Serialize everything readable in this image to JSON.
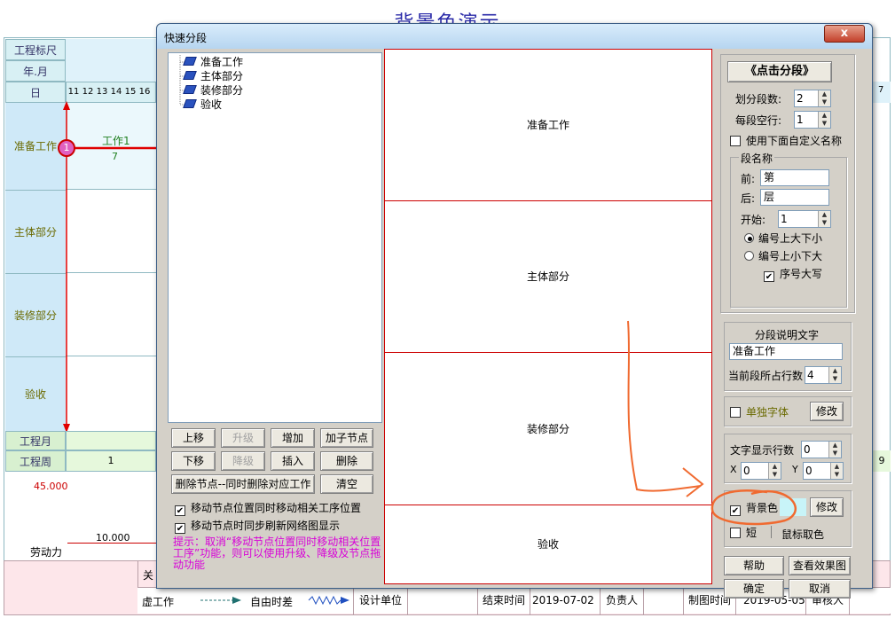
{
  "background": {
    "title": "背景色演示",
    "scale_label": "工程标尺",
    "yearmonth_label": "年.月",
    "day_label": "日",
    "days": [
      "11",
      "12",
      "13",
      "14",
      "15",
      "16"
    ],
    "lanes": [
      "准备工作",
      "主体部分",
      "装修部分",
      "验收"
    ],
    "task": {
      "name": "工作1",
      "duration": "7",
      "node": "1"
    },
    "month_label": "工程月",
    "week_label": "工程周",
    "week_first": "1",
    "week_right": "9",
    "day_right": "7",
    "value_top": "45.000",
    "value_mid": "10.000",
    "labor_label": "劳动力",
    "legend": {
      "crit_abbr": "关",
      "virtual": "虚工作",
      "free_float": "自由时差",
      "design_unit": "设计单位",
      "end_time_label": "结束时间",
      "end_time": "2019-07-02",
      "owner_label": "负责人",
      "draw_time_label": "制图时间",
      "draw_time": "2019-05-05",
      "reviewer_label": "审核人"
    }
  },
  "dialog": {
    "title": "快速分段",
    "close_label": "x",
    "tree_items": [
      "准备工作",
      "主体部分",
      "装修部分",
      "验收"
    ],
    "buttons": {
      "up": "上移",
      "promote": "升级",
      "add": "增加",
      "add_child": "加子节点",
      "down": "下移",
      "demote": "降级",
      "insert": "插入",
      "delete": "删除",
      "delete_node": "删除节点--同时删除对应工作",
      "clear": "清空"
    },
    "checks": {
      "move_related": "移动节点位置同时移动相关工序位置",
      "sync_refresh": "移动节点时同步刷新网络图显示"
    },
    "hint": "提示：取消“移动节点位置同时移动相关位置工序”功能，则可以使用升级、降级及节点拖动功能",
    "preview_segments": [
      "准备工作",
      "主体部分",
      "装修部分",
      "验收"
    ],
    "right": {
      "split_button": "《点击分段》",
      "seg_count_label": "划分段数:",
      "seg_count": "2",
      "blank_rows_label": "每段空行:",
      "blank_rows": "1",
      "use_custom_label": "使用下面自定义名称",
      "seg_name_group": "段名称",
      "prefix_label": "前:",
      "prefix": "第",
      "suffix_label": "后:",
      "suffix": "层",
      "start_label": "开始:",
      "start": "1",
      "order_big_small": "编号上大下小",
      "order_small_big": "编号上小下大",
      "uppercase": "序号大写",
      "desc_group": "分段说明文字",
      "desc_value": "准备工作",
      "rows_label": "当前段所占行数",
      "rows_value": "4",
      "separate_font": "单独字体",
      "modify": "修改",
      "text_rows_label": "文字显示行数",
      "text_rows": "0",
      "x_label": "X",
      "x_value": "0",
      "y_label": "Y",
      "y_value": "0",
      "bg_color_label": "背景色",
      "bg_color_value": "#c8f4f8",
      "short_label": "短",
      "mouse_color_label": "鼠标取色",
      "help": "帮助",
      "view_effect": "查看效果图",
      "ok": "确定",
      "cancel": "取消"
    }
  }
}
